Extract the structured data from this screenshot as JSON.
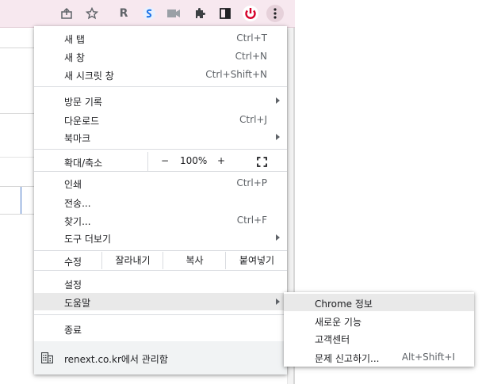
{
  "toolbar": {
    "icons": [
      "share-icon",
      "bookmark-star-icon",
      "r-extension-icon",
      "s-extension-icon",
      "video-icon",
      "extensions-puzzle-icon",
      "side-panel-icon",
      "power-icon",
      "more-menu-icon"
    ],
    "r_ext_label": "R",
    "accent_color": "#d6002a"
  },
  "menu": {
    "new_tab": {
      "label": "새 탭",
      "shortcut": "Ctrl+T"
    },
    "new_window": {
      "label": "새 창",
      "shortcut": "Ctrl+N"
    },
    "incognito": {
      "label": "새 시크릿 창",
      "shortcut": "Ctrl+Shift+N"
    },
    "history": {
      "label": "방문 기록"
    },
    "downloads": {
      "label": "다운로드",
      "shortcut": "Ctrl+J"
    },
    "bookmarks": {
      "label": "북마크"
    },
    "zoom": {
      "label": "확대/축소",
      "minus": "−",
      "value": "100%",
      "plus": "+"
    },
    "print": {
      "label": "인쇄",
      "shortcut": "Ctrl+P"
    },
    "cast": {
      "label": "전송..."
    },
    "find": {
      "label": "찾기...",
      "shortcut": "Ctrl+F"
    },
    "more_tools": {
      "label": "도구 더보기"
    },
    "edit": {
      "label": "수정",
      "cut": "잘라내기",
      "copy": "복사",
      "paste": "붙여넣기"
    },
    "settings": {
      "label": "설정"
    },
    "help": {
      "label": "도움말"
    },
    "exit": {
      "label": "종료"
    },
    "managed": {
      "label": "renext.co.kr에서 관리함"
    }
  },
  "submenu": {
    "about": {
      "label": "Chrome 정보"
    },
    "whats_new": {
      "label": "새로운 기능"
    },
    "help_center": {
      "label": "고객센터"
    },
    "report": {
      "label": "문제 신고하기...",
      "shortcut": "Alt+Shift+I"
    }
  }
}
